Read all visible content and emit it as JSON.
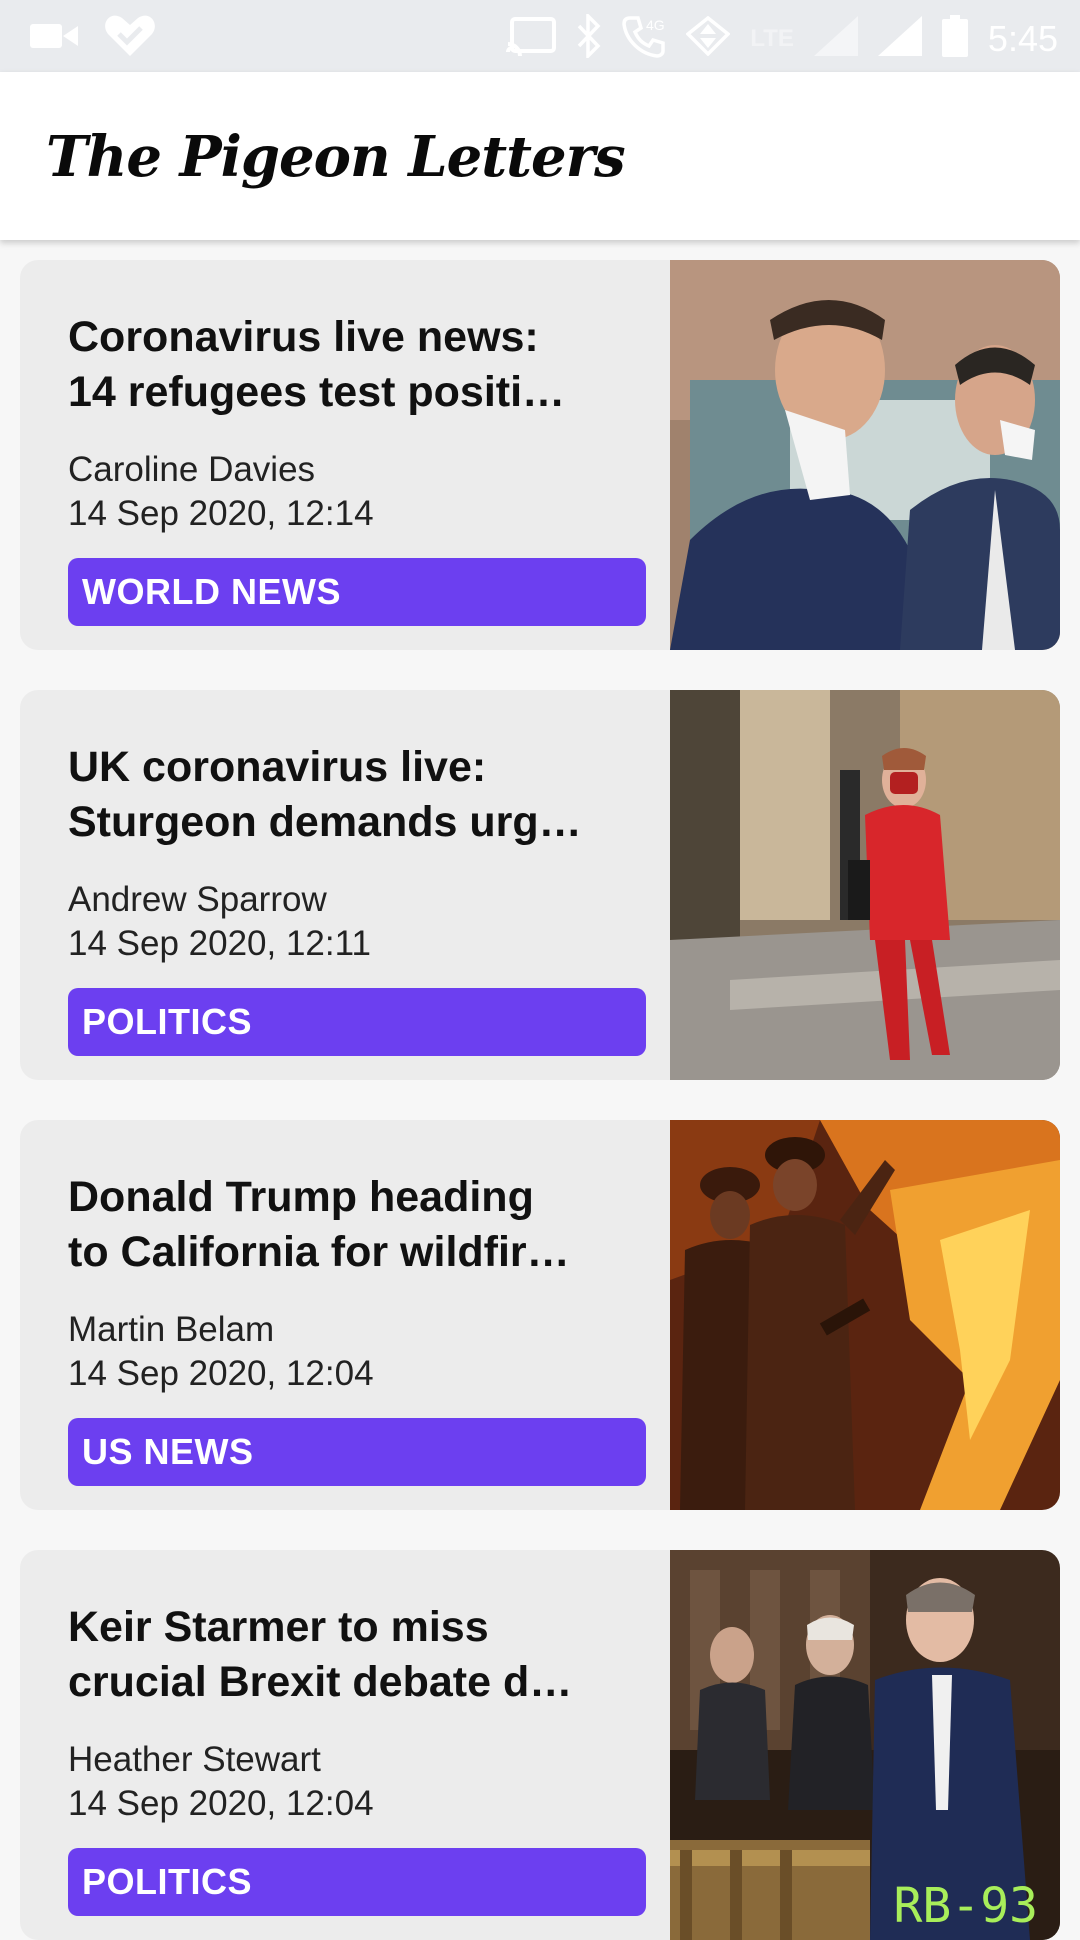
{
  "status_bar": {
    "time": "5:45",
    "network_label": "LTE",
    "data_label": "4G",
    "icons": [
      "video-camera-icon",
      "heart-check-icon",
      "cast-icon",
      "bluetooth-icon",
      "wifi-calling-icon",
      "data-transfer-icon",
      "signal-icon",
      "battery-icon"
    ]
  },
  "app_bar": {
    "title": "The Pigeon Letters"
  },
  "articles": [
    {
      "headline_line1": "Coronavirus live news:",
      "headline_line2": "14 refugees test positi…",
      "author": "Caroline Davies",
      "date": "14 Sep 2020, 12:14",
      "category": "WORLD NEWS",
      "image": "two-men-with-face-masks-photo"
    },
    {
      "headline_line1": "UK coronavirus live:",
      "headline_line2": "Sturgeon demands urg…",
      "author": "Andrew Sparrow",
      "date": "14 Sep 2020, 12:11",
      "category": "POLITICS",
      "image": "woman-in-red-suit-walking-photo"
    },
    {
      "headline_line1": "Donald Trump heading",
      "headline_line2": "to California for wildfir…",
      "author": "Martin Belam",
      "date": "14 Sep 2020, 12:04",
      "category": "US NEWS",
      "image": "firefighters-wildfire-photo"
    },
    {
      "headline_line1": "Keir Starmer to miss",
      "headline_line2": "crucial Brexit debate d…",
      "author": "Heather Stewart",
      "date": "14 Sep 2020, 12:04",
      "category": "POLITICS",
      "image": "parliament-speaker-photo",
      "watermark": "RB-93"
    }
  ],
  "colors": {
    "category_badge": "#6c3ff0",
    "card_background": "#ececec",
    "status_bar": "#e9ebee"
  }
}
